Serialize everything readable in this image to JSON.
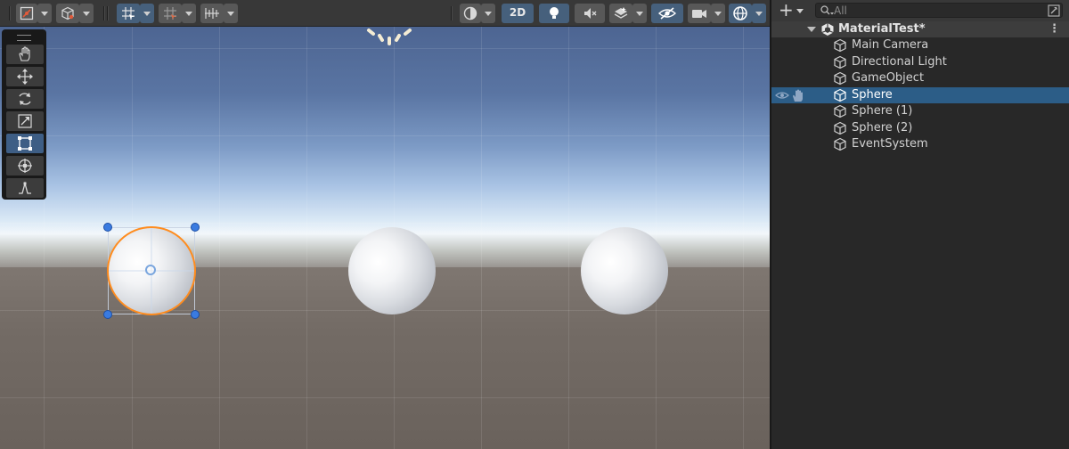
{
  "scene_toolbar": {
    "mode_2d_label": "2D",
    "icons": [
      "gizmo-icon",
      "cube-icon",
      "grid-snap-icon",
      "increment-snap-icon",
      "ruler-icon",
      "shading-sphere-icon",
      "light-bulb-icon",
      "audio-mute-icon",
      "effects-layers-icon",
      "visibility-eye-icon",
      "camera-icon",
      "gizmos-globe-icon"
    ]
  },
  "tools": [
    "hand",
    "move",
    "rotate",
    "scale",
    "rect",
    "transform",
    "custom-editor"
  ],
  "hierarchy": {
    "search_placeholder": "All",
    "scene_name": "MaterialTest*",
    "items": [
      {
        "label": "Main Camera",
        "selected": false
      },
      {
        "label": "Directional Light",
        "selected": false
      },
      {
        "label": "GameObject",
        "selected": false
      },
      {
        "label": "Sphere",
        "selected": true
      },
      {
        "label": "Sphere (1)",
        "selected": false
      },
      {
        "label": "Sphere (2)",
        "selected": false
      },
      {
        "label": "EventSystem",
        "selected": false
      }
    ]
  },
  "colors": {
    "selection_row": "#2c5d87",
    "selection_outline": "#ff8c1e",
    "handle_blue": "#3a7be0",
    "panel_bg": "#282828",
    "toolbar_bg": "#383838"
  }
}
